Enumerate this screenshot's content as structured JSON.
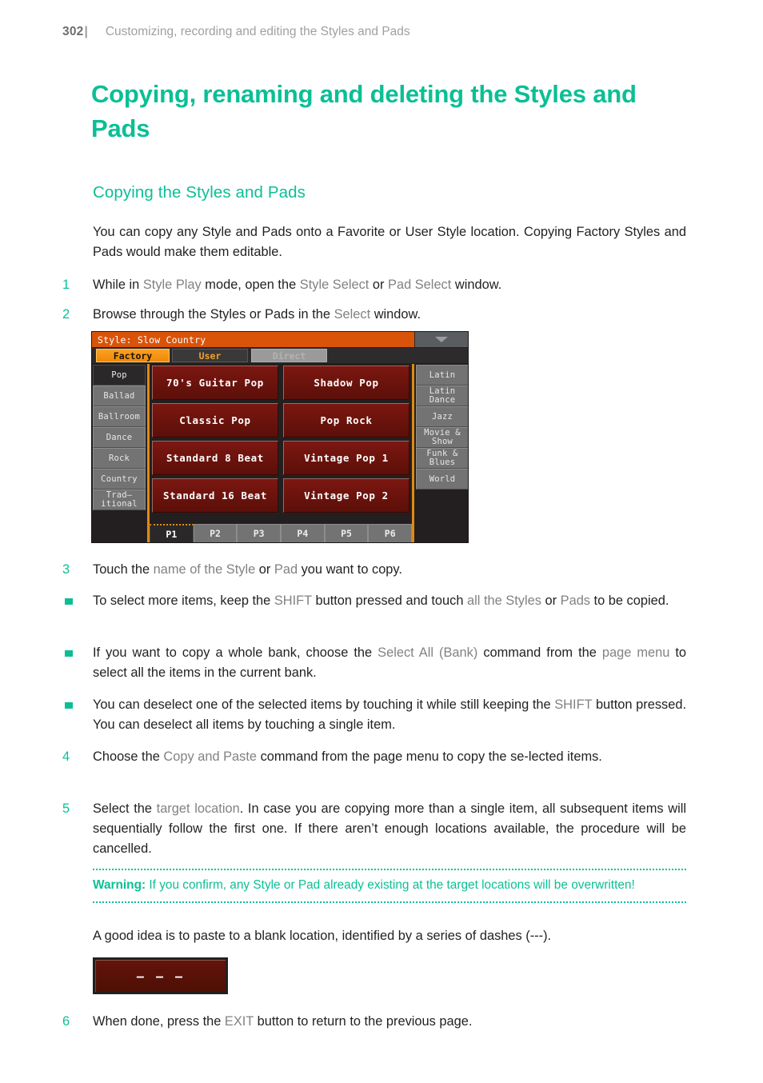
{
  "header": {
    "folio": "302",
    "separator": "|",
    "running_title": "Customizing, recording and editing the Styles and Pads"
  },
  "chapter_title": "Copying, renaming and deleting the Styles and Pads",
  "section_title": "Copying the Styles and Pads",
  "intro": "You can copy any Style and Pads onto a Favorite or User Style location. Copying Factory Styles and Pads would make them editable.",
  "steps": {
    "s1": {
      "marker": "1",
      "html": "While in <span class=\"kw\">Style Play</span> mode, open the <span class=\"kw\">Style Select</span> or <span class=\"kw\">Pad Select</span> window."
    },
    "s2": {
      "marker": "2",
      "html": "Browse through the Styles or Pads in the <span class=\"kw\">Select</span> window."
    },
    "s3": {
      "marker": "3",
      "html": "Touch the <span class=\"kw\">name of the Style</span> or <span class=\"kw\">Pad</span> you want to copy."
    },
    "b1": {
      "marker": "■",
      "html": "To select more items, keep the <span class=\"kw\">SHIFT</span> button pressed and touch <span class=\"kw\">all the Styles</span> or <span class=\"kw\">Pads</span> to be copied."
    },
    "b2": {
      "marker": "■",
      "html": "If you want to copy a whole bank, choose the <span class=\"kw\">Select All (Bank)</span> command from the <span class=\"kw\">page menu</span> to select all the items in the current bank."
    },
    "b3": {
      "marker": "■",
      "html": "You can deselect one of the selected items by touching it while still keeping the <span class=\"kw\">SHIFT</span> button pressed. You can deselect all items by touching a single item."
    },
    "s4": {
      "marker": "4",
      "html": "Choose the <span class=\"kw\">Copy and Paste</span> command from the page menu to copy the se-lected items."
    },
    "s5": {
      "marker": "5",
      "html": "Select the <span class=\"kw\">target location</span>. In case you are copying more than a single item, all subsequent items will sequentially follow the first one. If there aren’t enough locations available, the procedure will be cancelled."
    },
    "s6": {
      "marker": "6",
      "html": "When done, press the <span class=\"kw\">EXIT</span> button to return to the previous page."
    }
  },
  "warning": {
    "label": "Warning:",
    "text": " If you confirm, any Style or Pad already existing at the target locations will be overwritten!"
  },
  "blank_note": "A good idea is to paste to a blank location, identified by a series of dashes (---).",
  "blank_button": {
    "label": "– – –"
  },
  "screenshot": {
    "title": "Style: Slow Country",
    "menu_icon": "chevron-down-icon",
    "tabs": [
      {
        "label": "Factory",
        "state": "selected"
      },
      {
        "label": "User",
        "state": "normal"
      },
      {
        "label": "Direct",
        "state": "disabled"
      }
    ],
    "left_categories": [
      {
        "label": "Pop",
        "selected": true
      },
      {
        "label": "Ballad",
        "selected": false
      },
      {
        "label": "Ballroom",
        "selected": false
      },
      {
        "label": "Dance",
        "selected": false
      },
      {
        "label": "Rock",
        "selected": false
      },
      {
        "label": "Country",
        "selected": false
      },
      {
        "label": "Trad–",
        "label2": "itional",
        "selected": false
      }
    ],
    "right_categories": [
      {
        "label": "Latin"
      },
      {
        "label": "Latin",
        "label2": "Dance"
      },
      {
        "label": "Jazz"
      },
      {
        "label": "Movie &",
        "label2": "Show"
      },
      {
        "label": "Funk &",
        "label2": "Blues"
      },
      {
        "label": "World"
      }
    ],
    "styles": [
      "70's Guitar Pop",
      "Shadow Pop",
      "Classic Pop",
      "Pop Rock",
      "Standard 8 Beat",
      "Vintage Pop 1",
      "Standard 16 Beat",
      "Vintage Pop 2"
    ],
    "pages": [
      {
        "label": "P1",
        "selected": true
      },
      {
        "label": "P2",
        "selected": false
      },
      {
        "label": "P3",
        "selected": false
      },
      {
        "label": "P4",
        "selected": false
      },
      {
        "label": "P5",
        "selected": false
      },
      {
        "label": "P6",
        "selected": false
      }
    ]
  },
  "colors": {
    "accent_teal": "#0bbf95",
    "keyword_gray": "#808285",
    "screenshot_orange": "#d9540a",
    "tab_orange": "#f08806",
    "style_button_red": "#5c0f09"
  }
}
